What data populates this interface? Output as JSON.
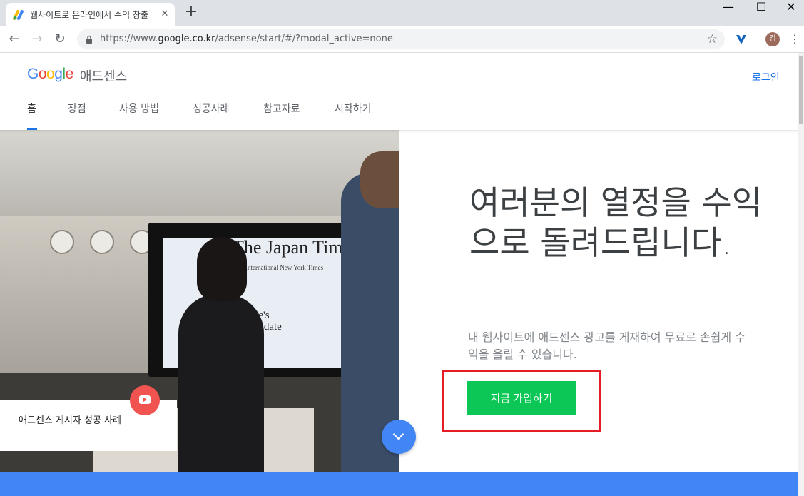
{
  "browser": {
    "tab_title": "웹사이트로 온라인에서 수익 창출",
    "tab_close": "✕",
    "new_tab": "+",
    "window_controls": {
      "minimize": "—",
      "maximize": "☐",
      "close": "✕"
    },
    "url_prefix": "https://www.",
    "url_host": "google.co.kr",
    "url_path": "/adsense/start/#/?modal_active=none",
    "avatar_initial": "김"
  },
  "header": {
    "logo_letters": [
      {
        "ch": "G",
        "color": "#4285f4"
      },
      {
        "ch": "o",
        "color": "#ea4335"
      },
      {
        "ch": "o",
        "color": "#fbbc05"
      },
      {
        "ch": "g",
        "color": "#4285f4"
      },
      {
        "ch": "l",
        "color": "#34a853"
      },
      {
        "ch": "e",
        "color": "#ea4335"
      }
    ],
    "product": "애드센스",
    "login": "로그인",
    "nav": [
      "홈",
      "장점",
      "사용 방법",
      "성공사례",
      "참고자료",
      "시작하기"
    ]
  },
  "hero": {
    "screen_title": "The Japan Times",
    "screen_sub": "International New York Times",
    "screen_head": "Abe's\nmandate",
    "caption": "애드센스 게시자 성공 사례",
    "headline": "여러분의 열정을 수익으로 돌려드립니다.",
    "subtext": "내 웹사이트에 애드센스 광고를 게재하여 무료로 손쉽게 수익을 올릴 수 있습니다.",
    "cta": "지금 가입하기"
  },
  "colors": {
    "accent_blue": "#1a73e8",
    "cta_green": "#0cc755",
    "highlight_red": "#e51c23",
    "band_blue": "#4285f4"
  }
}
